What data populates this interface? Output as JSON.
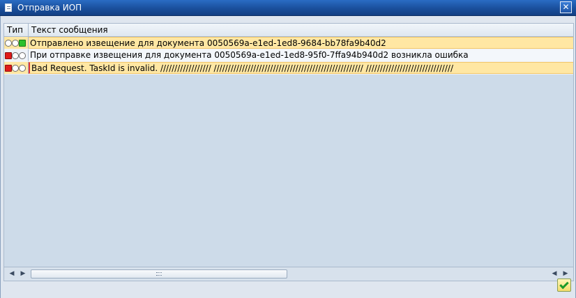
{
  "window": {
    "title": "Отправка ИОП",
    "close_icon": "✕"
  },
  "table": {
    "columns": [
      "Тип",
      "Текст сообщения"
    ],
    "rows": [
      {
        "status": "success",
        "lights": [
          "empty",
          "empty",
          "green"
        ],
        "text": "Отправлено извещение для документа 0050569a-e1ed-1ed8-9684-bb78fa9b40d2",
        "highlight": "yellow"
      },
      {
        "status": "error",
        "lights": [
          "red",
          "empty",
          "empty"
        ],
        "text": "При отправке извещения для документа 0050569a-e1ed-1ed8-95f0-7ffa94b940d2 возникла ошибка",
        "highlight": "none"
      },
      {
        "status": "error",
        "lights": [
          "red",
          "empty",
          "empty"
        ],
        "text": "Bad Request. TaskId is invalid. ////////////////// ///////////////////////////////////////////////////// ///////////////////////////////",
        "highlight": "yellow"
      }
    ]
  },
  "scrollbar": {
    "left_icon": "◀",
    "right_icon": "▶"
  },
  "footer": {
    "confirm_icon": "checkmark-icon"
  },
  "colors": {
    "titlebar": "#1a4f9c",
    "highlight": "#ffe7a3",
    "error_light": "#e01a1a",
    "success_light": "#2bc12b"
  }
}
